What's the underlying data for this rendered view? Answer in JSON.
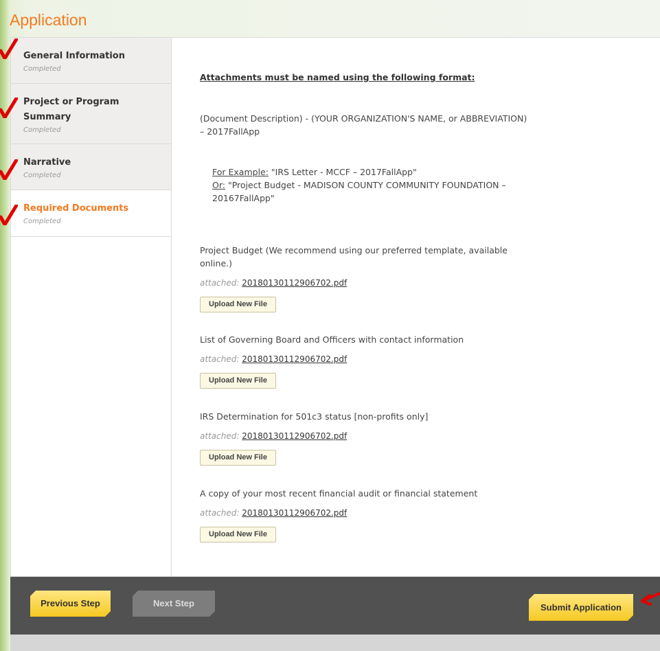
{
  "page": {
    "title": "Application"
  },
  "sidebar": {
    "steps": [
      {
        "label": "General Information",
        "status": "Completed"
      },
      {
        "label": "Project or Program Summary",
        "status": "Completed"
      },
      {
        "label": "Narrative",
        "status": "Completed"
      },
      {
        "label": "Required Documents",
        "status": "Completed"
      }
    ]
  },
  "content": {
    "heading": "Attachments must be named using the following format:",
    "format_text": "(Document Description) - (YOUR ORGANIZATION'S NAME, or ABBREVIATION) – 2017FallApp",
    "example1_label": "For Example:",
    "example1_text": " \"IRS Letter - MCCF – 2017FallApp\"",
    "example2_label": "Or:",
    "example2_text": " \"Project Budget - MADISON COUNTY COMMUNITY FOUNDATION – 20167FallApp\"",
    "attached_label": "attached:",
    "upload_label": "Upload New File",
    "documents": [
      {
        "title": "Project Budget (We recommend using our preferred template, available online.)",
        "file": "20180130112906702.pdf"
      },
      {
        "title": "List of Governing Board and Officers with contact information",
        "file": "20180130112906702.pdf"
      },
      {
        "title": "IRS Determination for 501c3 status [non-profits only]",
        "file": "20180130112906702.pdf"
      },
      {
        "title": "A copy of your most recent financial audit or financial statement",
        "file": "20180130112906702.pdf"
      }
    ]
  },
  "footer": {
    "previous_label": "Previous Step",
    "next_label": "Next Step",
    "submit_label": "Submit Application"
  },
  "colors": {
    "accent": "#f47a20",
    "button_yellow": "#f5c923",
    "footer_bg": "#515151",
    "annotation_red": "#e00000"
  }
}
